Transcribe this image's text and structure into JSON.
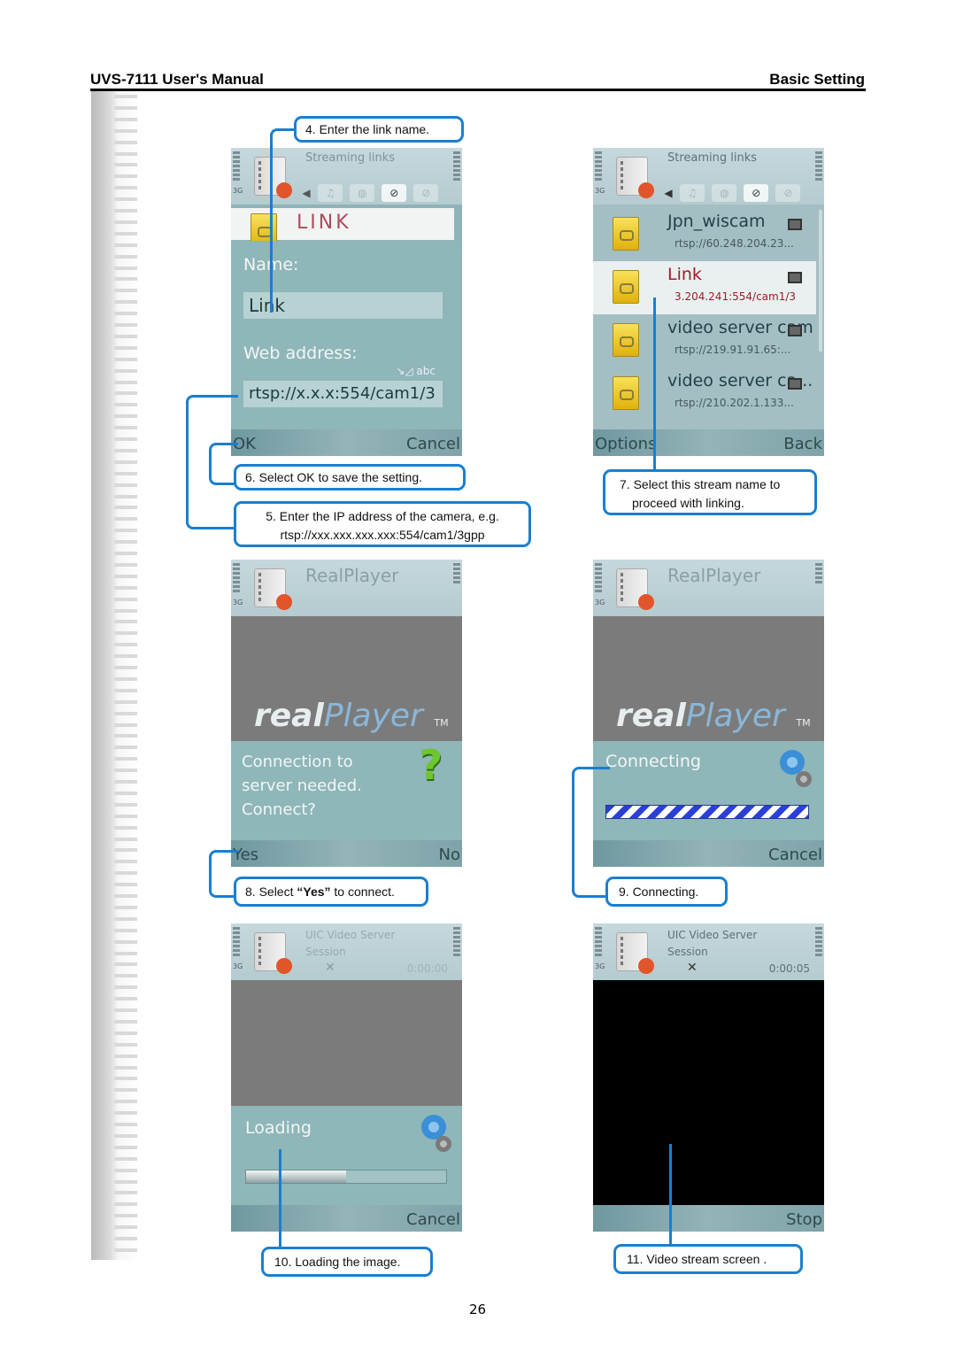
{
  "header": {
    "manual_title": "UVS-7111 User's Manual",
    "section_title": "Basic Setting"
  },
  "page_number": "26",
  "screens": {
    "link_edit": {
      "app_title": "Streaming links",
      "network": "3G",
      "list_item_title": "LINK",
      "name_label": "Name:",
      "name_value": "Link",
      "web_address_label": "Web address:",
      "input_mode": "abc",
      "web_address_value": "rtsp://x.x.x:554/cam1/3",
      "softkey_left": "OK",
      "softkey_right": "Cancel",
      "tab_icons": [
        "music-icon",
        "podcast-icon",
        "link-icon",
        "link-icon"
      ],
      "active_tab": 2
    },
    "link_list": {
      "app_title": "Streaming links",
      "network": "3G",
      "items": [
        {
          "name": "Jpn_wiscam",
          "url": "rtsp://60.248.204.23...",
          "selected": false
        },
        {
          "name": "Link",
          "url": "3.204.241:554/cam1/3",
          "selected": true
        },
        {
          "name": "video server cam",
          "url": "rtsp://219.91.91.65:...",
          "selected": false
        },
        {
          "name": "video server ca...",
          "url": "rtsp://210.202.1.133...",
          "selected": false
        }
      ],
      "softkey_left": "Options",
      "softkey_right": "Back"
    },
    "connect_prompt": {
      "app_title": "RealPlayer",
      "network": "3G",
      "logo_bold": "real",
      "logo_light": "Player",
      "logo_tm": "TM",
      "message_lines": [
        "Connection to",
        "server needed.",
        "Connect?"
      ],
      "softkey_left": "Yes",
      "softkey_right": "No"
    },
    "connecting": {
      "app_title": "RealPlayer",
      "network": "3G",
      "logo_bold": "real",
      "logo_light": "Player",
      "logo_tm": "TM",
      "status_text": "Connecting",
      "softkey_right": "Cancel"
    },
    "loading": {
      "app_title_line1": "UIC Video Server",
      "app_title_line2": "Session",
      "network": "3G",
      "timer": "0:00:00",
      "status_text": "Loading",
      "progress_fraction": 0.5,
      "softkey_right": "Cancel"
    },
    "video": {
      "app_title_line1": "UIC Video Server",
      "app_title_line2": "Session",
      "network": "3G",
      "timer": "0:00:05",
      "softkey_right": "Stop"
    }
  },
  "callouts": {
    "step4": "4. Enter the link name.",
    "step5_line1": "5. Enter the IP address of the camera, e.g.",
    "step5_line2": "rtsp://xxx.xxx.xxx.xxx:554/cam1/3gpp",
    "step6": "6. Select OK to save the setting.",
    "step7_line1": "7. Select this stream name to",
    "step7_line2": "proceed with linking.",
    "step8_prefix": "8. Select ",
    "step8_bold": "“Yes”",
    "step8_suffix": " to connect.",
    "step9": "9. Connecting.",
    "step10": "10. Loading the image.",
    "step11": "11. Video stream screen ."
  },
  "colors": {
    "callout_border": "#1a7fcf",
    "screen_teal": "#8fb6b9",
    "selected_text": "#9d1c2c"
  }
}
